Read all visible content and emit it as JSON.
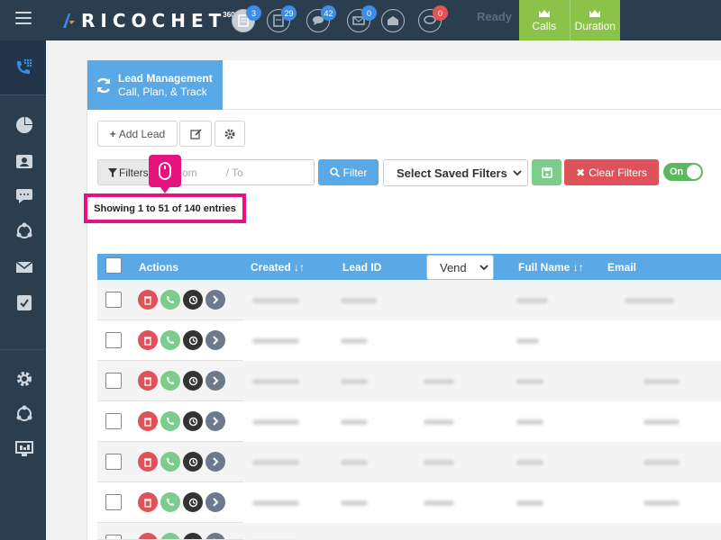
{
  "header": {
    "logo_text": "RICOCHET",
    "logo_sup": "360",
    "icons": [
      {
        "name": "docs-icon",
        "badge": "3"
      },
      {
        "name": "file-icon",
        "badge": "29"
      },
      {
        "name": "chat-icon",
        "badge": "42"
      },
      {
        "name": "mail-icon",
        "badge": "0"
      },
      {
        "name": "envelope-open-icon",
        "badge": ""
      },
      {
        "name": "sms-icon",
        "badge": "0"
      }
    ],
    "status": "Ready",
    "calls_label": "Calls",
    "duration_label": "Duration"
  },
  "page": {
    "tab_title": "Lead Management",
    "tab_subtitle": "Call, Plan, & Track"
  },
  "toolbar": {
    "add_lead": "Add Lead",
    "filters": "Filters",
    "from_placeholder": "om",
    "to_placeholder": "/  To",
    "filter_btn": "Filter",
    "saved_filters": "Select Saved Filters",
    "clear_filters": "Clear Filters",
    "toggle": "On"
  },
  "entries_text": "Showing 1 to 51 of 140 entries",
  "table": {
    "columns": {
      "actions": "Actions",
      "created": "Created",
      "lead_id": "Lead ID",
      "vendor": "Vend",
      "full_name": "Full Name",
      "email": "Email"
    }
  },
  "colors": {
    "accent": "#5aa9e6",
    "highlight": "#e6137e",
    "sidebar": "#2b3e50",
    "calls_green": "#8bc34a"
  }
}
